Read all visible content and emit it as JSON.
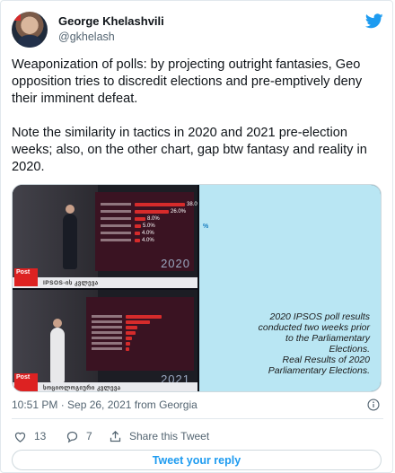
{
  "author": {
    "name": "George Khelashvili",
    "handle": "@gkhelash"
  },
  "tweet": {
    "text": "Weaponization of polls: by projecting outright fantasies, Geo opposition tries to discredit elections and pre-emptively deny their imminent defeat.\n\nNote the similarity in tactics in 2020 and 2021 pre-election weeks; also, on the other chart, gap btw fantasy and reality in 2020."
  },
  "media": {
    "top_shot": {
      "year": "2020",
      "bars": [
        {
          "value": "38.0",
          "fraction": 0.38,
          "color": "#d62b2b"
        },
        {
          "value": "26.0",
          "fraction": 0.26,
          "color": "#d62b2b"
        },
        {
          "value": "8.0",
          "fraction": 0.08,
          "color": "#d62b2b"
        },
        {
          "value": "5.0",
          "fraction": 0.05,
          "color": "#d62b2b"
        },
        {
          "value": "4.0",
          "fraction": 0.04,
          "color": "#d62b2b"
        },
        {
          "value": "4.0",
          "fraction": 0.04,
          "color": "#d62b2b"
        }
      ],
      "strap_post": "Post",
      "strap_caption": "IPSOS-ის კვლევა"
    },
    "bottom_shot": {
      "year": "2021",
      "bars": [
        {
          "value": "",
          "fraction": 0.38,
          "color": "#d62b2b"
        },
        {
          "value": "",
          "fraction": 0.26,
          "color": "#d62b2b"
        },
        {
          "value": "",
          "fraction": 0.12,
          "color": "#d62b2b"
        },
        {
          "value": "",
          "fraction": 0.1,
          "color": "#d62b2b"
        },
        {
          "value": "",
          "fraction": 0.07,
          "color": "#d62b2b"
        },
        {
          "value": "",
          "fraction": 0.05,
          "color": "#d62b2b"
        },
        {
          "value": "",
          "fraction": 0.04,
          "color": "#d62b2b"
        }
      ],
      "strap_post": "Post",
      "strap_caption": "სოციოლოგიური კვლევა"
    },
    "info_panel": {
      "marker": "%",
      "caption": "2020 IPSOS poll results\nconducted two weeks prior\nto the Parliamentary\nElections.\nReal Results of 2020\nParliamentary Elections."
    }
  },
  "meta": {
    "timestamp": "10:51 PM · Sep 26, 2021 from Georgia"
  },
  "actions": {
    "likes": "13",
    "replies": "7",
    "share_label": "Share this Tweet"
  },
  "reply_button": {
    "label": "Tweet your reply"
  },
  "colors": {
    "brand": "#1d9bf0",
    "text": "#0f1419",
    "secondary": "#536471",
    "info_panel_bg": "#b9e6f3",
    "poll_bar": "#d62b2b"
  },
  "icons": [
    "twitter-bird-icon",
    "info-icon",
    "heart-icon",
    "reply-icon",
    "share-icon"
  ]
}
